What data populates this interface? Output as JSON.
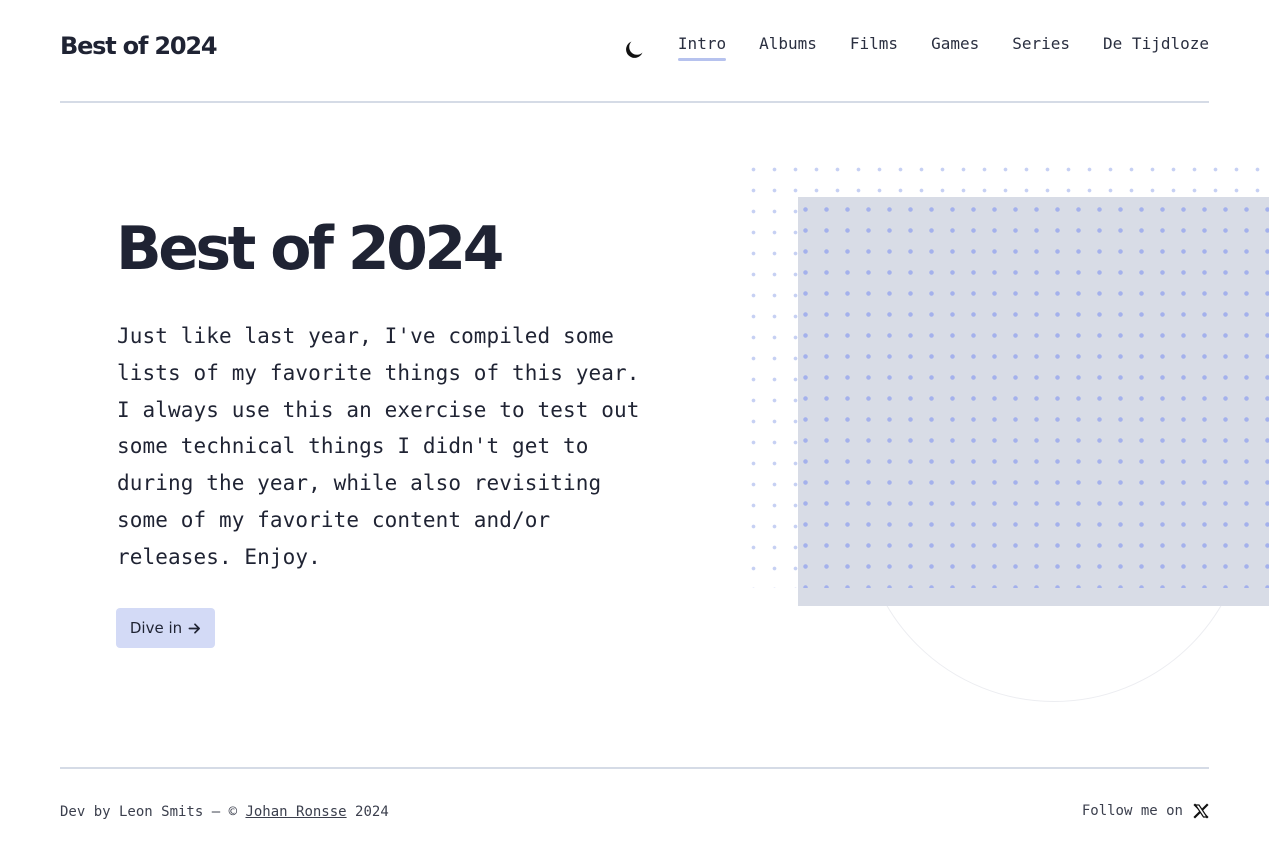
{
  "header": {
    "site_title": "Best of 2024",
    "theme_toggle_icon": "moon-icon",
    "nav": [
      {
        "label": "Intro",
        "active": true
      },
      {
        "label": "Albums",
        "active": false
      },
      {
        "label": "Films",
        "active": false
      },
      {
        "label": "Games",
        "active": false
      },
      {
        "label": "Series",
        "active": false
      },
      {
        "label": "De Tijdloze",
        "active": false
      }
    ]
  },
  "hero": {
    "title": "Best of 2024",
    "intro": "Just like last year, I've compiled some lists of my favorite things of this year. I always use this an exercise to test out some technical things I didn't get to during the year, while also revisiting some of my favorite content and/or releases. Enjoy.",
    "cta_label": "Dive in",
    "cta_icon": "arrow-right-icon"
  },
  "footer": {
    "credit_prefix": "Dev by Leon Smits – ©",
    "credit_link": "Johan Ronsse",
    "credit_suffix": "2024",
    "follow_label": "Follow me on",
    "follow_icon": "x-logo-icon"
  },
  "colors": {
    "text": "#1f2333",
    "accent": "#d3daf6",
    "nav_underline": "#b6c2ee",
    "divider": "#d5dbe6",
    "panel": "#d8dce6",
    "dots": "#a4b1ec"
  }
}
